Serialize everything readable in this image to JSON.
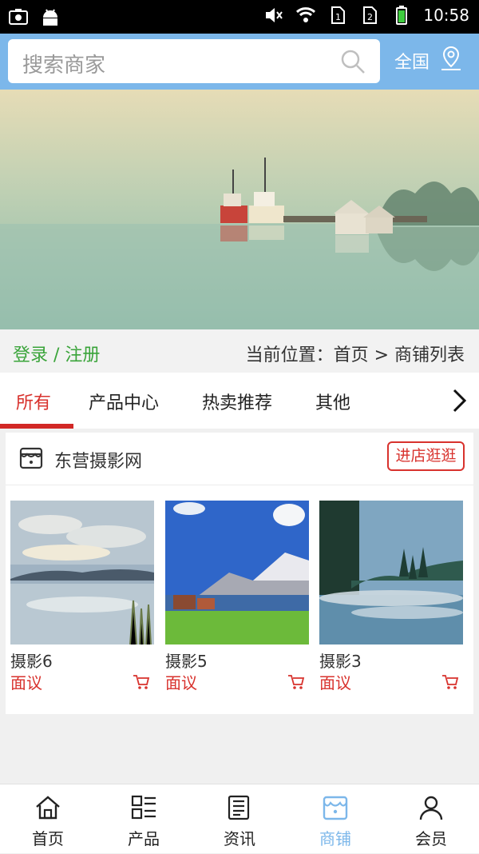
{
  "status": {
    "time": "10:58"
  },
  "search": {
    "placeholder": "搜索商家"
  },
  "region": {
    "label": "全国"
  },
  "auth": {
    "login_register": "登录 / 注册"
  },
  "breadcrumb": {
    "text": "当前位置：首页 > 商铺列表"
  },
  "tabs": [
    {
      "label": "所有",
      "active": true
    },
    {
      "label": "产品中心",
      "active": false
    },
    {
      "label": "热卖推荐",
      "active": false
    },
    {
      "label": "其他",
      "active": false
    }
  ],
  "shop": {
    "name": "东营摄影网",
    "enter_label": "进店逛逛",
    "products": [
      {
        "name": "摄影6",
        "price": "面议"
      },
      {
        "name": "摄影5",
        "price": "面议"
      },
      {
        "name": "摄影3",
        "price": "面议"
      }
    ]
  },
  "nav": [
    {
      "label": "首页",
      "icon": "home-icon"
    },
    {
      "label": "产品",
      "icon": "grid-list-icon"
    },
    {
      "label": "资讯",
      "icon": "news-icon"
    },
    {
      "label": "商铺",
      "icon": "shop-icon",
      "active": true
    },
    {
      "label": "会员",
      "icon": "user-icon"
    }
  ],
  "colors": {
    "header": "#7cb7ea",
    "accent_red": "#d8322d",
    "login_green": "#3aa43a"
  }
}
